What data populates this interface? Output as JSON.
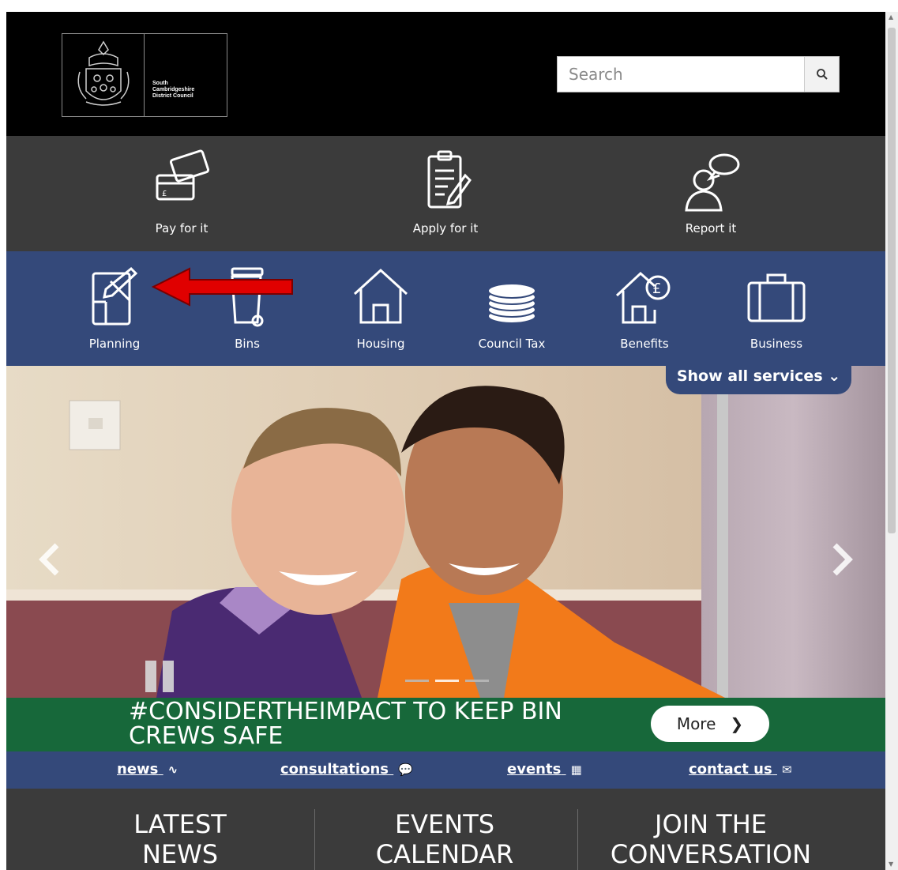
{
  "header": {
    "logo_text": [
      "South",
      "Cambridgeshire",
      "District Council"
    ],
    "search_placeholder": "Search"
  },
  "actions": [
    {
      "label": "Pay for it",
      "icon": "credit-card-icon"
    },
    {
      "label": "Apply for it",
      "icon": "clipboard-icon"
    },
    {
      "label": "Report it",
      "icon": "speech-person-icon"
    }
  ],
  "services": [
    {
      "label": "Planning",
      "icon": "planning-icon"
    },
    {
      "label": "Bins",
      "icon": "bin-icon"
    },
    {
      "label": "Housing",
      "icon": "house-icon"
    },
    {
      "label": "Council Tax",
      "icon": "coins-icon"
    },
    {
      "label": "Benefits",
      "icon": "house-pound-icon"
    },
    {
      "label": "Business",
      "icon": "briefcase-icon"
    }
  ],
  "show_all": "Show all services ⌄",
  "banner": {
    "title": "#CONSIDERTHEIMPACT TO KEEP BIN CREWS SAFE",
    "more_label": "More",
    "more_chevron": "❯"
  },
  "quicklinks": [
    {
      "label": "news",
      "icon": "rss-icon",
      "glyph": "∿"
    },
    {
      "label": "consultations",
      "icon": "speech-bubble-icon",
      "glyph": "💬"
    },
    {
      "label": "events",
      "icon": "calendar-icon",
      "glyph": "▦"
    },
    {
      "label": "contact us",
      "icon": "envelope-icon",
      "glyph": "✉"
    }
  ],
  "columns": [
    {
      "line1": "LATEST",
      "line2": "NEWS"
    },
    {
      "line1": "EVENTS",
      "line2": "CALENDAR"
    },
    {
      "line1": "JOIN THE",
      "line2": "CONVERSATION"
    }
  ],
  "colors": {
    "header_bg": "#000000",
    "actions_bg": "#3b3b3b",
    "services_bg": "#34497a",
    "banner_bg": "#17683a",
    "annotation_arrow": "#e00000"
  }
}
